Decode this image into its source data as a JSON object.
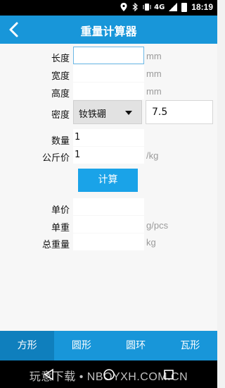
{
  "status_bar": {
    "network": "4G",
    "time": "18:19"
  },
  "header": {
    "title": "重量计算器"
  },
  "form": {
    "length": {
      "label": "长度",
      "value": "",
      "unit": "mm"
    },
    "width": {
      "label": "宽度",
      "value": "",
      "unit": "mm"
    },
    "height": {
      "label": "高度",
      "value": "",
      "unit": "mm"
    },
    "density": {
      "label": "密度",
      "material": "钕铁硼",
      "value": "7.5"
    },
    "quantity": {
      "label": "数量",
      "value": "1"
    },
    "price_per_kg": {
      "label": "公斤价",
      "value": "1",
      "unit": "/kg"
    },
    "calc_button": "计算",
    "unit_price": {
      "label": "单价",
      "value": ""
    },
    "unit_weight": {
      "label": "单重",
      "value": "",
      "unit": "g/pcs"
    },
    "total_weight": {
      "label": "总重量",
      "value": "",
      "unit": "kg"
    }
  },
  "tabs": [
    {
      "label": "方形",
      "selected": true
    },
    {
      "label": "圆形",
      "selected": false
    },
    {
      "label": "圆环",
      "selected": false
    },
    {
      "label": "瓦形",
      "selected": false
    }
  ],
  "watermark": "玩意下载 • NBOYXH.COM.CN",
  "colors": {
    "primary": "#1896d9",
    "tab_selected": "#0f7fbd",
    "button": "#1aa3e8"
  }
}
